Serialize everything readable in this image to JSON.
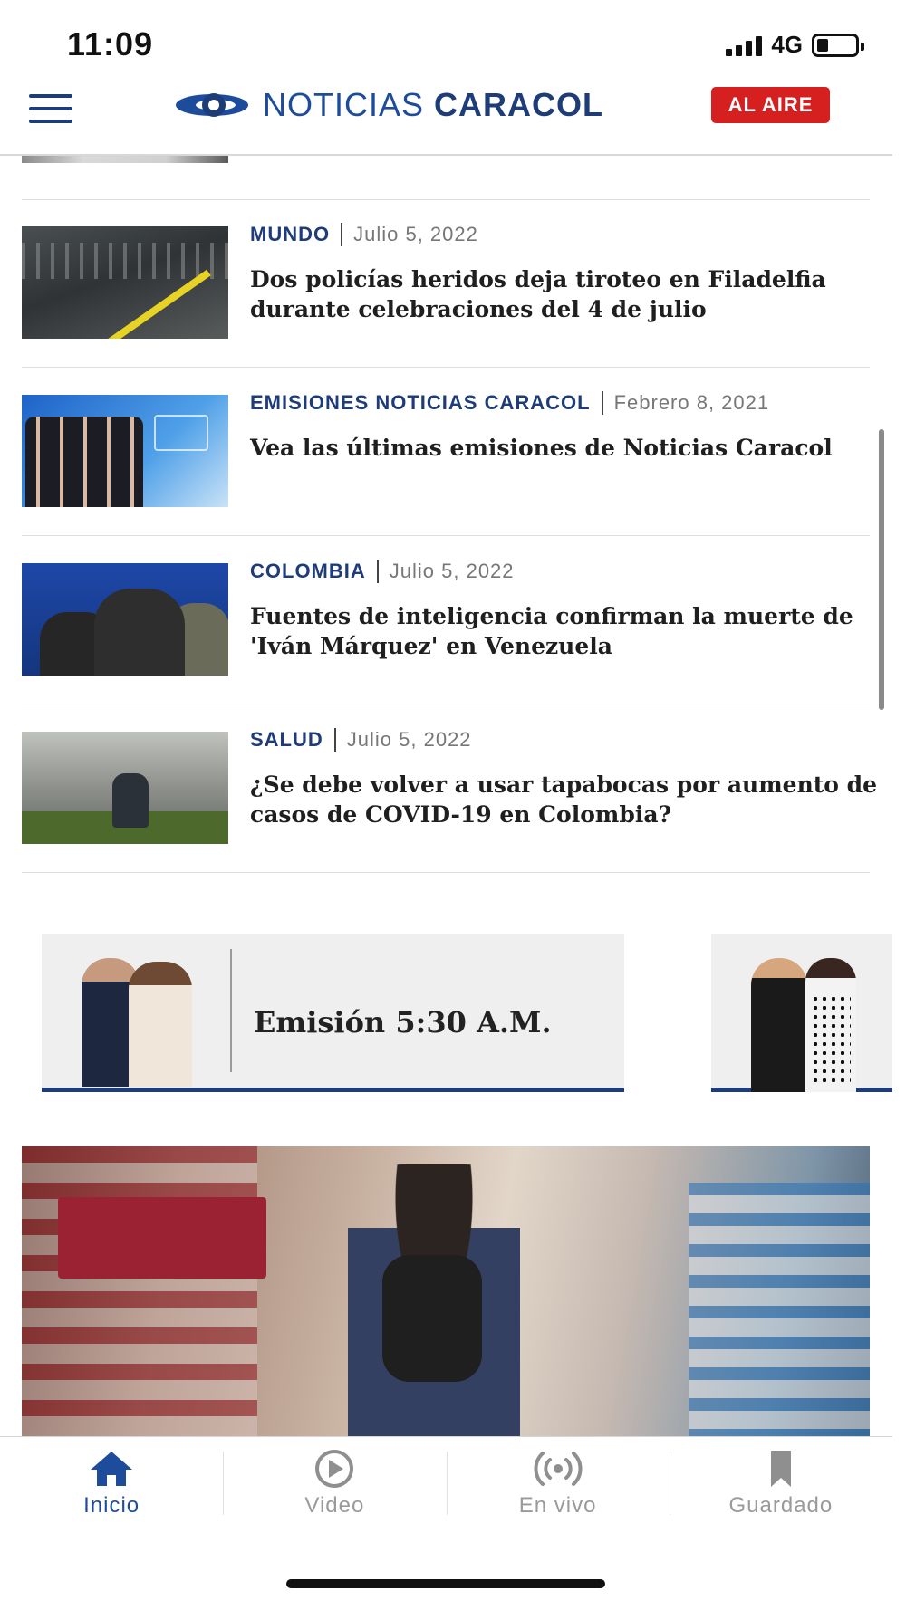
{
  "status_bar": {
    "time": "11:09",
    "network": "4G"
  },
  "header": {
    "logo_light": "NOTICIAS",
    "logo_bold": "CARACOL",
    "live_label": "AL AIRE",
    "brand_color": "#1d3c78",
    "live_color": "#d62020"
  },
  "news": [
    {
      "category": "MUNDO",
      "date": "Julio 5, 2022",
      "title": "Dos policías heridos deja tiroteo en Filadelfia durante celebraciones del 4 de julio"
    },
    {
      "category": "EMISIONES NOTICIAS CARACOL",
      "date": "Febrero 8, 2021",
      "title": "Vea las últimas emisiones de Noticias Caracol"
    },
    {
      "category": "COLOMBIA",
      "date": "Julio 5, 2022",
      "title": "Fuentes de inteligencia confirman la muerte de 'Iván Márquez' en Venezuela"
    },
    {
      "category": "SALUD",
      "date": "Julio 5, 2022",
      "title": "¿Se debe volver a usar tapabocas por aumento de casos de COVID-19 en Colombia?"
    }
  ],
  "emissions": [
    {
      "title": "Emisión 5:30 A.M."
    }
  ],
  "tabs": [
    {
      "label": "Inicio",
      "icon": "home-icon",
      "active": true
    },
    {
      "label": "Video",
      "icon": "play-icon",
      "active": false
    },
    {
      "label": "En vivo",
      "icon": "live-broadcast-icon",
      "active": false
    },
    {
      "label": "Guardado",
      "icon": "bookmark-icon",
      "active": false
    }
  ]
}
